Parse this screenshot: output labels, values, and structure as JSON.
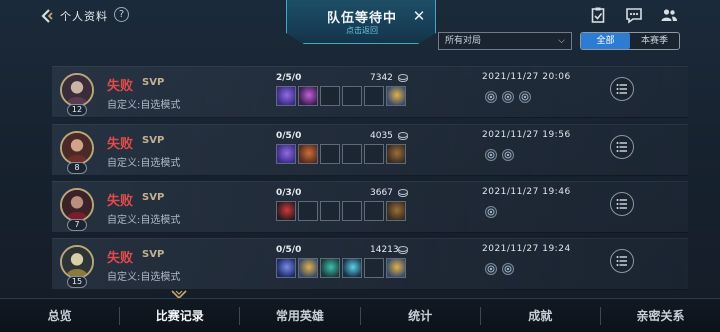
{
  "header": {
    "title": "个人资料",
    "help_label": "?",
    "waiting_title": "队伍等待中",
    "waiting_sub": "点击返回",
    "close_label": "✕"
  },
  "filters": {
    "mode_select": "所有对局",
    "season_tabs": [
      "全部",
      "本赛季"
    ],
    "active_season_tab": 0
  },
  "colors": {
    "defeat": "#e04a4a",
    "accent": "#2c7cd1"
  },
  "matches": [
    {
      "result": "失败",
      "svp": "SVP",
      "mode": "自定义:自选模式",
      "level": "12",
      "kda": "2/5/0",
      "gold": "7342",
      "date": "2021/11/27 20:06",
      "items": [
        "item-purple",
        "item-violet",
        "empty",
        "empty",
        "empty",
        "item-gold"
      ],
      "badges": 3
    },
    {
      "result": "失败",
      "svp": "SVP",
      "mode": "自定义:自选模式",
      "level": "8",
      "kda": "0/5/0",
      "gold": "4035",
      "date": "2021/11/27 19:56",
      "items": [
        "item-purple",
        "item-book",
        "empty",
        "empty",
        "empty",
        "item-brown"
      ],
      "badges": 2
    },
    {
      "result": "失败",
      "svp": "SVP",
      "mode": "自定义:自选模式",
      "level": "7",
      "kda": "0/3/0",
      "gold": "3667",
      "date": "2021/11/27 19:46",
      "items": [
        "item-red",
        "empty",
        "empty",
        "empty",
        "empty",
        "item-brown"
      ],
      "badges": 1
    },
    {
      "result": "失败",
      "svp": "SVP",
      "mode": "自定义:自选模式",
      "level": "15",
      "kda": "0/5/0",
      "gold": "14213",
      "date": "2021/11/27 19:24",
      "items": [
        "item-blue",
        "item-gold",
        "item-teal",
        "item-cyan",
        "empty",
        "item-gold"
      ],
      "badges": 2
    }
  ],
  "bottom_tabs": [
    "总览",
    "比赛记录",
    "常用英雄",
    "统计",
    "成就",
    "亲密关系"
  ],
  "active_bottom_tab": 1
}
